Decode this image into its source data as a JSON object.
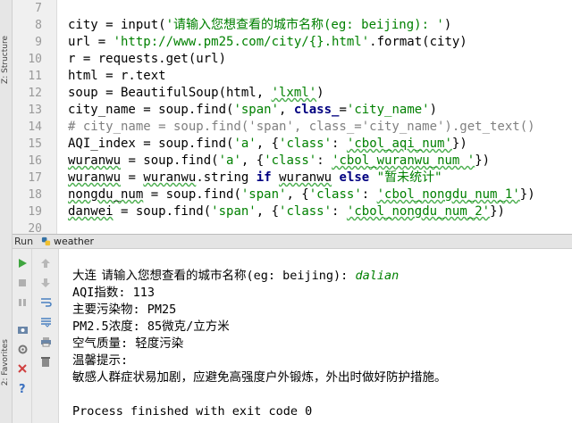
{
  "sidebar": {
    "structure_label": "Z: Structure",
    "favorites_label": "2: Favorites"
  },
  "editor": {
    "line_numbers": [
      "7",
      "8",
      "9",
      "10",
      "11",
      "12",
      "13",
      "14",
      "15",
      "16",
      "17",
      "18",
      "19",
      "20"
    ],
    "lines": [
      {
        "parts": []
      },
      {
        "parts": [
          {
            "t": "city = input("
          },
          {
            "t": "'请输入您想查看的城市名称(eg: beijing): '",
            "c": "str"
          },
          {
            "t": ")"
          }
        ]
      },
      {
        "parts": [
          {
            "t": "url = "
          },
          {
            "t": "'http://www.pm25.com/city/{}.html'",
            "c": "str"
          },
          {
            "t": ".format(city)"
          }
        ]
      },
      {
        "parts": [
          {
            "t": "r = requests.get(url)"
          }
        ]
      },
      {
        "parts": [
          {
            "t": "html = r.text"
          }
        ]
      },
      {
        "parts": [
          {
            "t": "soup = BeautifulSoup(html, "
          },
          {
            "t": "'lxml'",
            "c": "str ul"
          },
          {
            "t": ")"
          }
        ]
      },
      {
        "parts": [
          {
            "t": "city_name = soup.find("
          },
          {
            "t": "'span'",
            "c": "str"
          },
          {
            "t": ", "
          },
          {
            "t": "class_",
            "c": "kw"
          },
          {
            "t": "="
          },
          {
            "t": "'city_name'",
            "c": "str"
          },
          {
            "t": ")"
          }
        ]
      },
      {
        "parts": [
          {
            "t": "# city_name = soup.find('span', class_='city_name').get_text()",
            "c": "com"
          }
        ]
      },
      {
        "parts": [
          {
            "t": "AQI_index = soup.find("
          },
          {
            "t": "'a'",
            "c": "str"
          },
          {
            "t": ", {"
          },
          {
            "t": "'class'",
            "c": "str"
          },
          {
            "t": ": "
          },
          {
            "t": "'cbol_aqi_num'",
            "c": "str ul"
          },
          {
            "t": "})"
          }
        ]
      },
      {
        "parts": [
          {
            "t": "wuranwu",
            "c": "ul"
          },
          {
            "t": " = soup.find("
          },
          {
            "t": "'a'",
            "c": "str"
          },
          {
            "t": ", {"
          },
          {
            "t": "'class'",
            "c": "str"
          },
          {
            "t": ": "
          },
          {
            "t": "'cbol_wuranwu_num '",
            "c": "str ul"
          },
          {
            "t": "})"
          }
        ]
      },
      {
        "parts": [
          {
            "t": "wuranwu",
            "c": "ul"
          },
          {
            "t": " = "
          },
          {
            "t": "wuranwu",
            "c": "ul"
          },
          {
            "t": ".string "
          },
          {
            "t": "if",
            "c": "kw"
          },
          {
            "t": " "
          },
          {
            "t": "wuranwu",
            "c": "ul"
          },
          {
            "t": " "
          },
          {
            "t": "else",
            "c": "kw"
          },
          {
            "t": " "
          },
          {
            "t": "\"暂未统计\"",
            "c": "str"
          }
        ]
      },
      {
        "parts": [
          {
            "t": "nongdu_num",
            "c": "ul"
          },
          {
            "t": " = soup.find("
          },
          {
            "t": "'span'",
            "c": "str"
          },
          {
            "t": ", {"
          },
          {
            "t": "'class'",
            "c": "str"
          },
          {
            "t": ": "
          },
          {
            "t": "'cbol_nongdu_num_1'",
            "c": "str ul"
          },
          {
            "t": "})"
          }
        ]
      },
      {
        "parts": [
          {
            "t": "danwei",
            "c": "ul"
          },
          {
            "t": " = soup.find("
          },
          {
            "t": "'span'",
            "c": "str"
          },
          {
            "t": ", {"
          },
          {
            "t": "'class'",
            "c": "str"
          },
          {
            "t": ": "
          },
          {
            "t": "'cbol_nongdu_num_2'",
            "c": "str ul"
          },
          {
            "t": "})"
          }
        ]
      },
      {
        "parts": []
      }
    ]
  },
  "run_panel": {
    "label": "Run",
    "tab": "weather",
    "prompt": "请输入您想查看的城市名称(eg: beijing): ",
    "user_input": "dalian",
    "output_lines": [
      "大连",
      "AQI指数: 113",
      "主要污染物: PM25",
      "PM2.5浓度: 85微克/立方米",
      "空气质量: 轻度污染",
      "温馨提示:",
      "敏感人群症状易加剧，应避免高强度户外锻炼，外出时做好防护措施。",
      "",
      "Process finished with exit code 0"
    ]
  },
  "colors": {
    "run_green": "#3fa53f",
    "stop_red": "#d04040"
  }
}
